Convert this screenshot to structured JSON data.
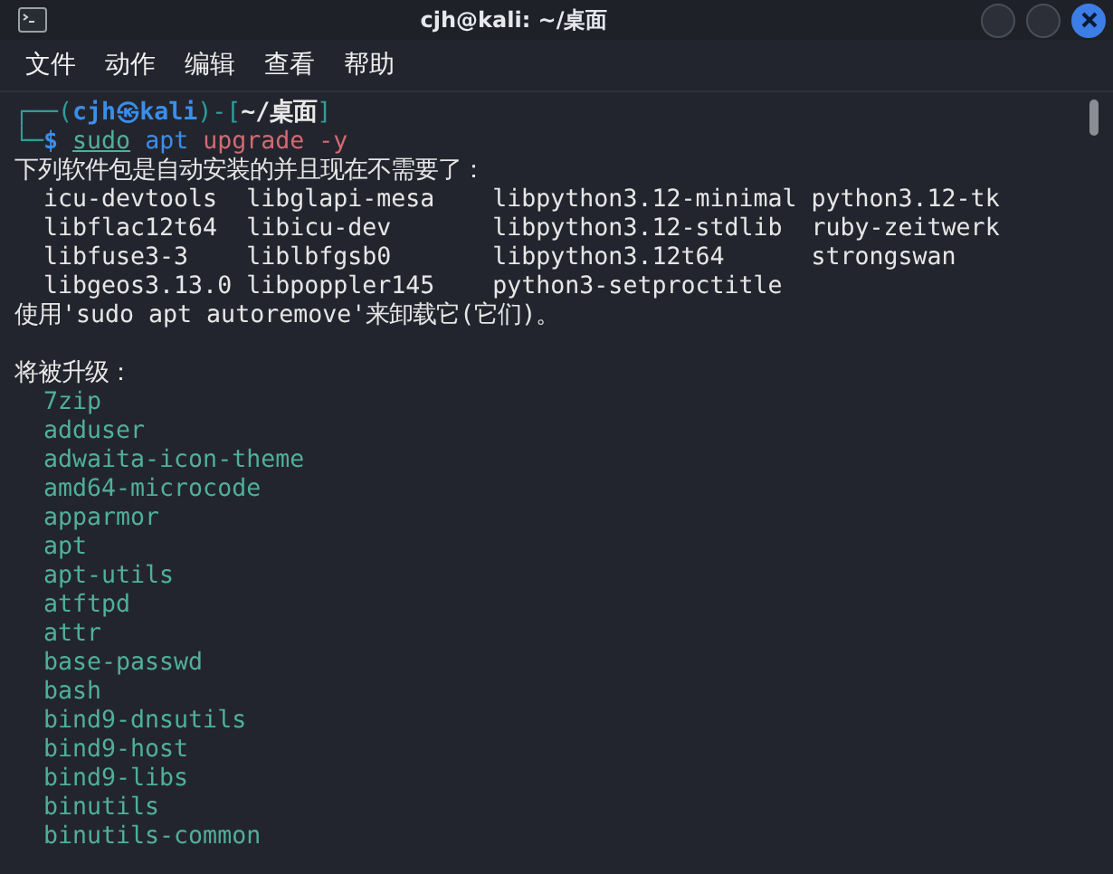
{
  "window": {
    "title": "cjh@kali: ~/桌面"
  },
  "menu": [
    "文件",
    "动作",
    "编辑",
    "查看",
    "帮助"
  ],
  "prompt": {
    "open": "┌──(",
    "user": "cjh",
    "at": "㉿",
    "host": "kali",
    "mid": ")-[",
    "path": "~/桌面",
    "close": "]",
    "corner": "└─",
    "dollar": "$",
    "command": [
      {
        "kind": "sudo",
        "text": "sudo"
      },
      {
        "kind": "cmd",
        "text": "apt"
      },
      {
        "kind": "arg",
        "text": "upgrade -y"
      }
    ]
  },
  "not_needed_heading": "下列软件包是自动安装的并且现在不需要了：",
  "not_needed": [
    [
      "icu-devtools",
      "libglapi-mesa",
      "libpython3.12-minimal",
      "python3.12-tk"
    ],
    [
      "libflac12t64",
      "libicu-dev",
      "libpython3.12-stdlib",
      "ruby-zeitwerk"
    ],
    [
      "libfuse3-3",
      "liblbfgsb0",
      "libpython3.12t64",
      "strongswan"
    ],
    [
      "libgeos3.13.0",
      "libpoppler145",
      "python3-setproctitle"
    ]
  ],
  "autoremove_hint": "使用'sudo apt autoremove'来卸载它(它们)。",
  "upgrade_heading": "将被升级：",
  "upgrades": [
    "7zip",
    "adduser",
    "adwaita-icon-theme",
    "amd64-microcode",
    "apparmor",
    "apt",
    "apt-utils",
    "atftpd",
    "attr",
    "base-passwd",
    "bash",
    "bind9-dnsutils",
    "bind9-host",
    "bind9-libs",
    "binutils",
    "binutils-common"
  ]
}
